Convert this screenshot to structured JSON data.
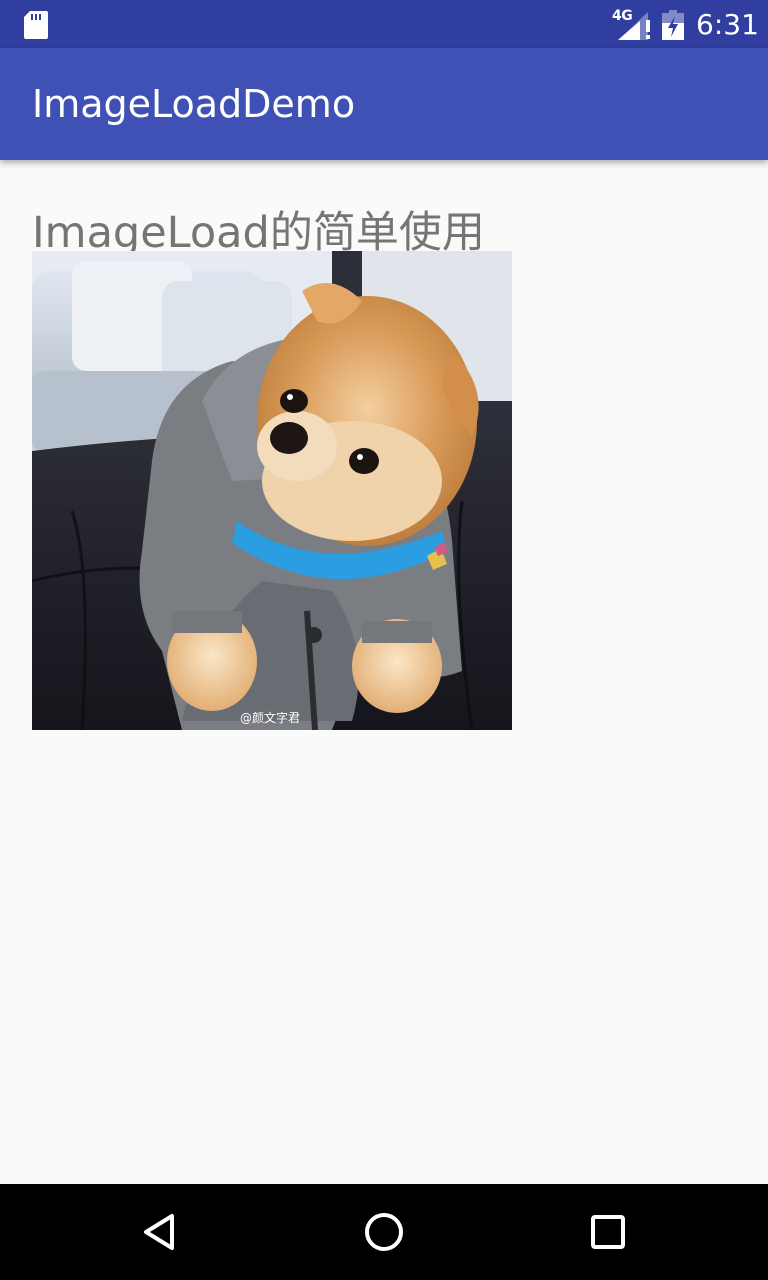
{
  "status_bar": {
    "network_label": "4G",
    "time": "6:31"
  },
  "app_bar": {
    "title": "ImageLoadDemo"
  },
  "main": {
    "heading": "ImageLoad的简单使用",
    "image": {
      "subject": "pomeranian-puppy-photo",
      "watermark": "@颜文字君"
    }
  },
  "nav_bar": {
    "buttons": [
      "back",
      "home",
      "recents"
    ]
  },
  "colors": {
    "status_bar": "#303f9f",
    "app_bar": "#3f51b5",
    "background": "#fafafa",
    "heading_text": "#757575",
    "nav_bar": "#000000"
  }
}
